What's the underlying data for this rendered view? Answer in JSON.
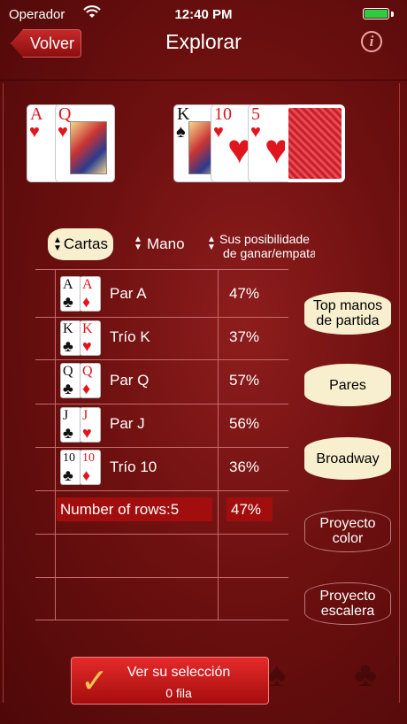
{
  "status": {
    "carrier": "Operador",
    "time": "12:40 PM",
    "battery_level": 1.0
  },
  "nav": {
    "back_label": "Volver",
    "title": "Explorar",
    "info_label": "i"
  },
  "top_hands": {
    "hand1": [
      {
        "rank": "A",
        "suit": "♥",
        "color": "red"
      },
      {
        "rank": "Q",
        "suit": "♥",
        "color": "red",
        "face": true
      }
    ],
    "hand2": [
      {
        "rank": "K",
        "suit": "♠",
        "color": "black",
        "face": true
      },
      {
        "rank": "10",
        "suit": "♥",
        "color": "red"
      },
      {
        "rank": "5",
        "suit": "♥",
        "color": "red"
      },
      {
        "back": true
      }
    ]
  },
  "columns": {
    "cartas": "Cartas",
    "mano": "Mano",
    "posibilidades_l1": "Sus posibilidade",
    "posibilidades_l2": "de ganar/empata"
  },
  "rows": [
    {
      "c1": "A",
      "s1": "♣",
      "col1": "black",
      "c2": "A",
      "s2": "♦",
      "col2": "red",
      "hand": "Par A",
      "pct": "47%"
    },
    {
      "c1": "K",
      "s1": "♣",
      "col1": "black",
      "c2": "K",
      "s2": "♥",
      "col2": "red",
      "hand": "Trío K",
      "pct": "37%"
    },
    {
      "c1": "Q",
      "s1": "♣",
      "col1": "black",
      "c2": "Q",
      "s2": "♦",
      "col2": "red",
      "hand": "Par Q",
      "pct": "57%"
    },
    {
      "c1": "J",
      "s1": "♣",
      "col1": "black",
      "c2": "J",
      "s2": "♥",
      "col2": "red",
      "hand": "Par J",
      "pct": "56%"
    },
    {
      "c1": "10",
      "s1": "♣",
      "col1": "black",
      "c2": "10",
      "s2": "♦",
      "col2": "red",
      "hand": "Trío 10",
      "pct": "36%"
    }
  ],
  "summary": {
    "rows_label": "Number of rows:5",
    "pct": "47%"
  },
  "side_buttons": {
    "top": "Top manos de partida",
    "pares": "Pares",
    "broadway": "Broadway",
    "proyecto_color": "Proyecto color",
    "proyecto_escalera": "Proyecto escalera"
  },
  "selection": {
    "title": "Ver su selección",
    "count": "0 fila"
  }
}
